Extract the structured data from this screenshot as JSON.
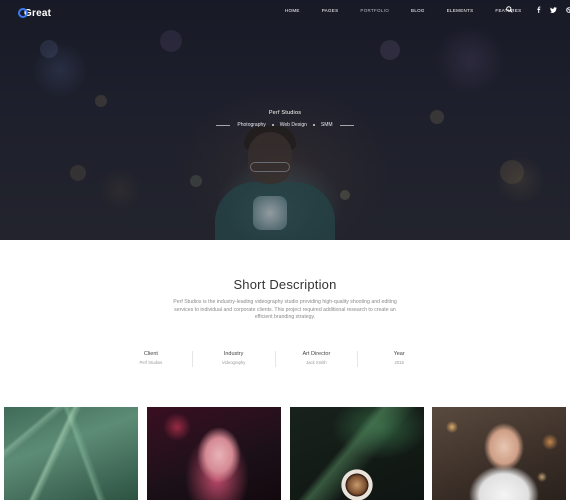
{
  "brand": {
    "logo_text": "Great",
    "accent_color": "#3d7bf5"
  },
  "nav": {
    "items": [
      {
        "label": "HOME"
      },
      {
        "label": "PAGES"
      },
      {
        "label": "PORTFOLIO"
      },
      {
        "label": "BLOG"
      },
      {
        "label": "ELEMENTS"
      },
      {
        "label": "FEATURES"
      }
    ],
    "active_item": "PORTFOLIO",
    "icons": [
      "search-icon",
      "facebook-icon",
      "twitter-icon",
      "dribbble-icon"
    ]
  },
  "hero": {
    "title": "Perf Studios",
    "tags": [
      "Photography",
      "Web Design",
      "SMM"
    ]
  },
  "description": {
    "title": "Short Description",
    "text": "Perf Studios is the industry-leading videography studio providing high-quality shooting and editing services to individual and corporate clients. This project required additional research to create an efficient branding strategy."
  },
  "meta": [
    {
      "label": "Client",
      "value": "Perf Studios"
    },
    {
      "label": "Industry",
      "value": "Videography"
    },
    {
      "label": "Art Director",
      "value": "Jack Smith"
    },
    {
      "label": "Year",
      "value": "2018"
    }
  ]
}
